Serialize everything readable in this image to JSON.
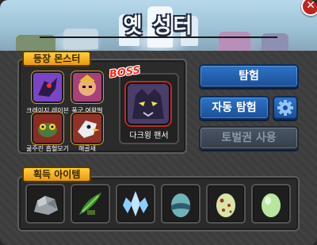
{
  "title": "옛 성터",
  "monsters_section": {
    "label": "등장 몬스터",
    "monsters": [
      {
        "name": "크레이지 레이븐",
        "icon": "crazy-raven-portrait"
      },
      {
        "name": "폭군 여왕벌",
        "icon": "tyrant-queen-bee-portrait"
      },
      {
        "name": "굶주린 흡혈모기",
        "icon": "hungry-vampire-mosquito-portrait"
      },
      {
        "name": "해골새",
        "icon": "skull-bird-portrait"
      }
    ],
    "boss": {
      "tag": "BOSS",
      "name": "다크윙 팬서",
      "icon": "darkwing-panther-portrait"
    }
  },
  "actions": {
    "explore_label": "탐험",
    "auto_explore_label": "자동 탐험",
    "use_ticket_label": "토벌권 사용",
    "settings_icon": "gear-icon"
  },
  "items_section": {
    "label": "획득 아이템",
    "items": [
      {
        "icon": "stone-ore-icon"
      },
      {
        "icon": "green-herb-icon"
      },
      {
        "icon": "ice-crystal-icon"
      },
      {
        "icon": "teal-egg-icon"
      },
      {
        "icon": "spotted-egg-icon"
      },
      {
        "icon": "green-egg-icon"
      }
    ]
  },
  "colors": {
    "accent_gold": "#e79a12",
    "button_blue": "#1d4f97",
    "button_disabled": "#363e4a",
    "boss_red": "#ff2a1a"
  }
}
